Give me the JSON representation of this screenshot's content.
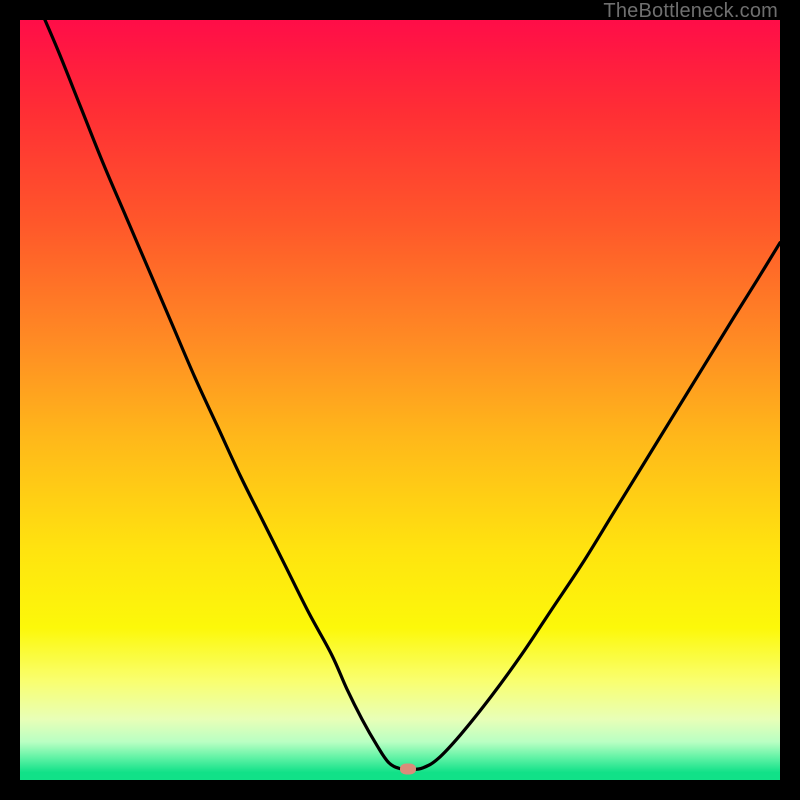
{
  "watermark": "TheBottleneck.com",
  "colors": {
    "background": "#000000",
    "curve": "#000000",
    "marker": "#da8c7a",
    "gradient_top": "#ff0d48",
    "gradient_mid": "#ffe40f",
    "gradient_bottom": "#11e188"
  },
  "chart_data": {
    "type": "line",
    "title": "",
    "xlabel": "",
    "ylabel": "",
    "xlim": [
      0,
      100
    ],
    "ylim": [
      0,
      100
    ],
    "grid": false,
    "legend": false,
    "x": [
      0,
      2,
      5,
      8,
      11,
      14,
      17,
      20,
      23,
      26,
      29,
      32,
      35,
      38,
      41,
      43,
      45,
      47,
      48.5,
      50,
      51.5,
      53,
      55,
      58,
      62,
      66,
      70,
      74,
      78,
      82,
      86,
      90,
      94,
      97,
      100
    ],
    "values": [
      108,
      103,
      96,
      88.5,
      81,
      74,
      67,
      60,
      53,
      46.5,
      40,
      34,
      28,
      22,
      16.5,
      12,
      8,
      4.5,
      2.3,
      1.5,
      1.4,
      1.6,
      2.8,
      6,
      11,
      16.5,
      22.5,
      28.5,
      35,
      41.5,
      48,
      54.5,
      61,
      65.8,
      70.7
    ],
    "annotations": [
      {
        "type": "marker",
        "x": 51,
        "y": 1.5
      }
    ]
  }
}
